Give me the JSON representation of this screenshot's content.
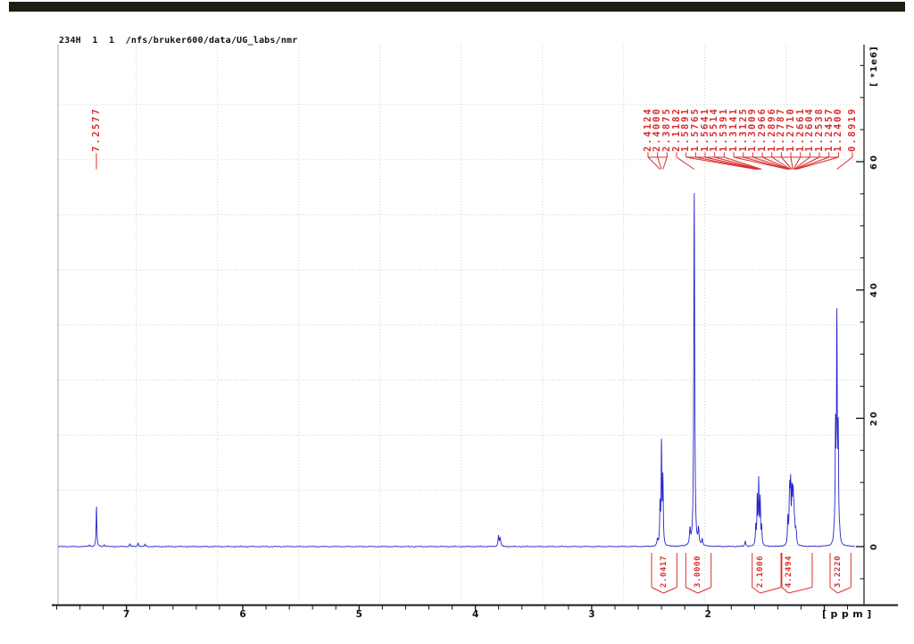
{
  "window": {
    "topbar_color": "#1d1d14",
    "background_color": "#ffffff"
  },
  "header": {
    "title": "234H  1  1  /nfs/bruker600/data/UG_labs/nmr"
  },
  "chart_data": {
    "type": "line",
    "kind": "1H NMR spectrum (Bruker TopSpin print view)",
    "title": "234H  1  1  /nfs/bruker600/data/UG_labs/nmr",
    "xlabel": "[ppm]",
    "ylabel": "[ *1e6]",
    "xlim": [
      7.63,
      0.66
    ],
    "ylim": [
      -9,
      78
    ],
    "x_major_ticks": [
      7,
      6,
      5,
      4,
      3,
      2,
      1
    ],
    "x_tick_labels": [
      "7",
      "6",
      "5",
      "4",
      "3",
      "2"
    ],
    "x_minor_step": 0.2,
    "y_major_ticks": [
      0,
      20,
      40,
      60
    ],
    "y_tick_labels": [
      "0",
      "20",
      "40",
      "60"
    ],
    "y_minor_step": 5,
    "grid": "light dotted page grid, not aligned to axis ticks",
    "line_color": "#2424cb",
    "annotation_color": "#d92f2f",
    "axis_color": "#1a1a1a",
    "peaks": [
      {
        "ppm": 7.2577,
        "height": 6.2,
        "label": "7.2577"
      },
      {
        "ppm": 2.4124,
        "height": 6.0,
        "label": "2.4124"
      },
      {
        "ppm": 2.4,
        "height": 15.5,
        "label": "2.4000"
      },
      {
        "ppm": 2.3875,
        "height": 10.3,
        "label": "2.3875"
      },
      {
        "ppm": 2.1182,
        "height": 55.0,
        "label": "2.1182",
        "w": 0.0045
      },
      {
        "ppm": 1.5891,
        "height": 2.9,
        "label": "1.5891"
      },
      {
        "ppm": 1.5765,
        "height": 7.2,
        "label": "1.5765"
      },
      {
        "ppm": 1.5641,
        "height": 9.8,
        "label": "1.5641"
      },
      {
        "ppm": 1.5514,
        "height": 7.0,
        "label": "1.5514"
      },
      {
        "ppm": 1.5391,
        "height": 2.8,
        "label": "1.5391"
      },
      {
        "ppm": 1.3141,
        "height": 2.0,
        "label": "1.3141"
      },
      {
        "ppm": 1.3125,
        "height": 2.3,
        "label": "1.3125"
      },
      {
        "ppm": 1.3009,
        "height": 4.2,
        "label": "1.3009"
      },
      {
        "ppm": 1.2966,
        "height": 6.2,
        "label": "1.2966"
      },
      {
        "ppm": 1.2896,
        "height": 8.4,
        "label": "1.2896"
      },
      {
        "ppm": 1.2787,
        "height": 7.2,
        "label": "1.2787"
      },
      {
        "ppm": 1.271,
        "height": 5.6,
        "label": "1.2710"
      },
      {
        "ppm": 1.2661,
        "height": 5.0,
        "label": "1.2661"
      },
      {
        "ppm": 1.2604,
        "height": 3.6,
        "label": "1.2604"
      },
      {
        "ppm": 1.2538,
        "height": 2.6,
        "label": "1.2538"
      },
      {
        "ppm": 1.2457,
        "height": 1.7,
        "label": "1.2457"
      },
      {
        "ppm": 1.24,
        "height": 1.4,
        "label": "1.2400"
      },
      {
        "ppm": 0.8919,
        "height": 34.2,
        "label": "0.8919",
        "w": 0.004
      }
    ],
    "minor_peaks": [
      [
        7.32,
        0.3
      ],
      [
        7.19,
        0.3
      ],
      [
        6.97,
        0.4
      ],
      [
        6.9,
        0.55
      ],
      [
        6.84,
        0.35
      ],
      [
        3.801,
        1.6
      ],
      [
        3.787,
        1.3
      ],
      [
        2.434,
        1.0
      ],
      [
        2.155,
        2.3
      ],
      [
        2.081,
        2.4
      ],
      [
        2.05,
        1.0
      ],
      [
        1.679,
        0.8
      ],
      [
        0.9155,
        1.3
      ],
      [
        0.9036,
        16.5,
        0.0036
      ],
      [
        0.8802,
        16.0,
        0.0036
      ],
      [
        0.868,
        1.2
      ]
    ],
    "label_groups": [
      [
        1,
        2,
        3
      ],
      [
        4
      ],
      [
        5,
        6,
        7,
        8,
        9
      ],
      [
        10,
        11,
        12,
        13,
        14,
        15,
        16,
        17,
        18,
        19,
        20,
        21
      ],
      [
        22
      ]
    ],
    "integrals": [
      {
        "label": "2.0417",
        "from_ppm": 2.485,
        "to_ppm": 2.268,
        "label_ppm": 2.383
      },
      {
        "label": "3.0000",
        "from_ppm": 2.191,
        "to_ppm": 1.973,
        "label_ppm": 2.088
      },
      {
        "label": "2.1006",
        "from_ppm": 1.62,
        "to_ppm": 1.372,
        "label_ppm": 1.551
      },
      {
        "label": "4.2494",
        "from_ppm": 1.365,
        "to_ppm": 1.104,
        "label_ppm": 1.308
      },
      {
        "label": "3.2220",
        "from_ppm": 0.95,
        "to_ppm": 0.771,
        "label_ppm": 0.886
      }
    ]
  }
}
